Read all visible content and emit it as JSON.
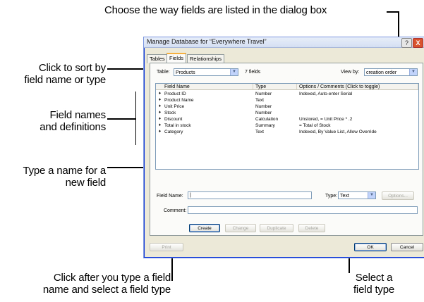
{
  "callouts": {
    "top": "Choose the way fields are listed in the dialog box",
    "sort_line1": "Click to sort by",
    "sort_line2": "field name or type",
    "names_line1": "Field names",
    "names_line2": "and definitions",
    "newfield_line1": "Type a name for a",
    "newfield_line2": "new field",
    "create_line1": "Click after you type a field",
    "create_line2": "name and select a field type",
    "type_line1": "Select a",
    "type_line2": "field type"
  },
  "dialog": {
    "title": "Manage Database for “Everywhere Travel”",
    "help": "?",
    "close": "X",
    "tabs": [
      "Tables",
      "Fields",
      "Relationships"
    ],
    "active_tab": "Fields",
    "table_label": "Table:",
    "table_value": "Products",
    "field_count": "7 fields",
    "view_by_label": "View by:",
    "view_by_value": "creation order",
    "columns": [
      "Field Name",
      "Type",
      "Options / Comments  (Click to toggle)"
    ],
    "rows": [
      {
        "name": "Product ID",
        "type": "Number",
        "options": "Indexed, Auto-enter Serial"
      },
      {
        "name": "Product Name",
        "type": "Text",
        "options": ""
      },
      {
        "name": "Unit Price",
        "type": "Number",
        "options": ""
      },
      {
        "name": "Stock",
        "type": "Number",
        "options": ""
      },
      {
        "name": "Discount",
        "type": "Calculation",
        "options": "Unstored, = Unit Price * .2"
      },
      {
        "name": "Total in stock",
        "type": "Summary",
        "options": "= Total of Stock"
      },
      {
        "name": "Category",
        "type": "Text",
        "options": "Indexed, By Value List, Allow Override"
      }
    ],
    "field_name_label": "Field Name:",
    "field_name_value": "|",
    "type_label": "Type:",
    "type_value": "Text",
    "options_button": "Options...",
    "comment_label": "Comment:",
    "comment_value": "",
    "buttons": {
      "create": "Create",
      "change": "Change",
      "duplicate": "Duplicate",
      "delete": "Delete"
    },
    "print": "Print",
    "ok": "OK",
    "cancel": "Cancel"
  }
}
